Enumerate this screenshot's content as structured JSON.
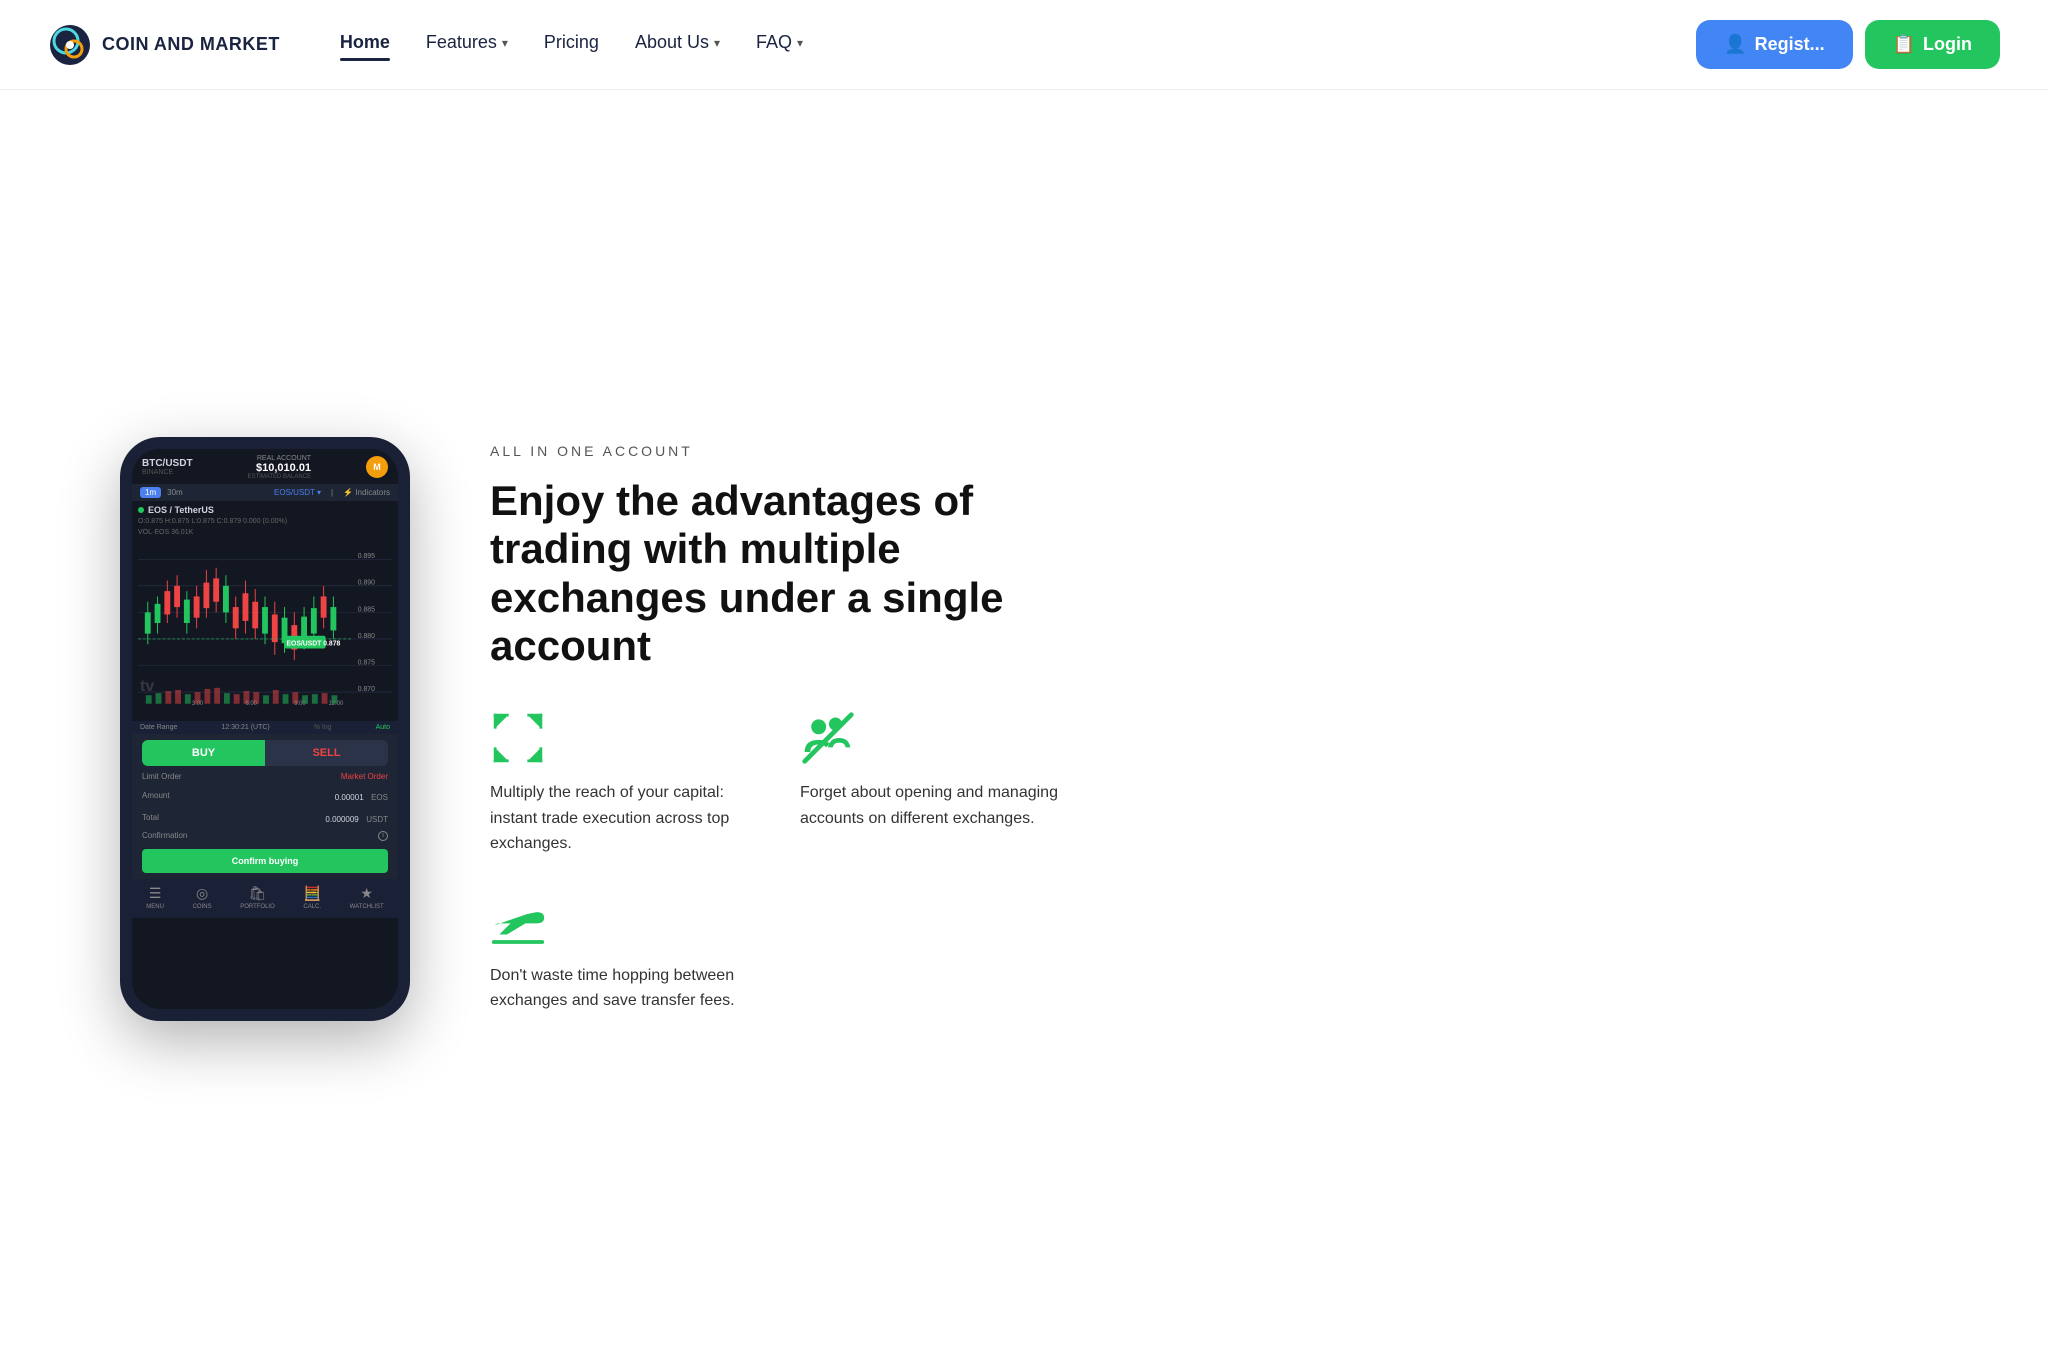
{
  "nav": {
    "logo_text": "COIN AND MARKET",
    "links": [
      {
        "label": "Home",
        "active": true,
        "has_dropdown": false
      },
      {
        "label": "Features",
        "active": false,
        "has_dropdown": true
      },
      {
        "label": "Pricing",
        "active": false,
        "has_dropdown": false
      },
      {
        "label": "About Us",
        "active": false,
        "has_dropdown": true
      },
      {
        "label": "FAQ",
        "active": false,
        "has_dropdown": true
      }
    ],
    "register_label": "Regist...",
    "login_label": "Login"
  },
  "phone": {
    "pair": "BTC/USDT",
    "exchange": "BINANCE",
    "real_account_label": "REAL ACCOUNT",
    "estimated_balance_label": "ESTIMATED BALANCE",
    "balance": "$10,010.01",
    "avatar_initial": "M",
    "timeframes": [
      "1m",
      "30m"
    ],
    "active_timeframe": "1m",
    "symbol": "EOS / TetherUS",
    "prices_row": "0.575  H0.875  L0.875  C0.879  0.000 (0.00%)",
    "vol_label": "VOL: EOS",
    "vol_value": "36.01K",
    "chart_price_labels": [
      "0.895",
      "0.890",
      "0.885",
      "0.880",
      "0.875",
      "0.870"
    ],
    "current_price": "0.878",
    "time_labels": [
      "3:00",
      "6:00",
      "9:00",
      "12:00"
    ],
    "date_range": "Date Range",
    "time_utc": "12:30:21 (UTC)",
    "buy_label": "BUY",
    "sell_label": "SELL",
    "limit_order": "Limit Order",
    "market_order": "Market Order",
    "amount_label": "Amount",
    "amount_value": "0.00001",
    "amount_unit": "EOS",
    "total_label": "Total",
    "total_value": "0.000009",
    "total_unit": "USDT",
    "confirmation_label": "Confirmation",
    "confirm_buying_label": "Confirm buying",
    "bottom_nav": [
      "MENU",
      "COINS",
      "PORTFOLIO",
      "CALC.",
      "WATCHLIST"
    ]
  },
  "hero": {
    "section_label": "ALL IN ONE ACCOUNT",
    "heading": "Enjoy the advantages of trading with multiple exchanges under a single account",
    "features": [
      {
        "icon_type": "expand-arrows",
        "text": "Multiply the reach of your capital: instant trade execution across top exchanges."
      },
      {
        "icon_type": "no-people",
        "text": "Forget about opening and managing accounts on different exchanges."
      },
      {
        "icon_type": "takeoff",
        "text": "Don't waste time hopping between exchanges and save transfer fees."
      },
      {
        "icon_type": "empty",
        "text": ""
      }
    ]
  }
}
